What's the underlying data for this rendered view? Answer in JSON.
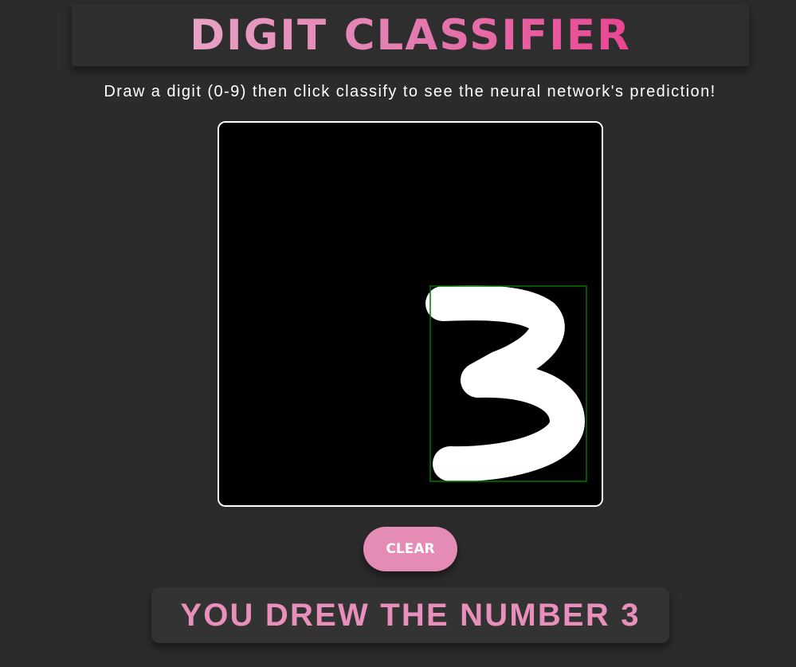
{
  "header": {
    "title": "DIGIT CLASSIFIER"
  },
  "instructions": {
    "text": "Draw a digit (0-9) then click classify to see the neural network's prediction!"
  },
  "canvas": {
    "background_color": "#000000",
    "stroke_color": "#ffffff",
    "bounding_box_color": "#007700",
    "drawn_digit": "3"
  },
  "controls": {
    "clear_label": "CLEAR"
  },
  "result": {
    "text": "YOU DREW THE NUMBER 3"
  },
  "colors": {
    "page_background": "#2b2b2b",
    "accent_pink": "#e58cb6",
    "title_gradient_start": "#e8a2c4",
    "title_gradient_end": "#ea4592"
  }
}
